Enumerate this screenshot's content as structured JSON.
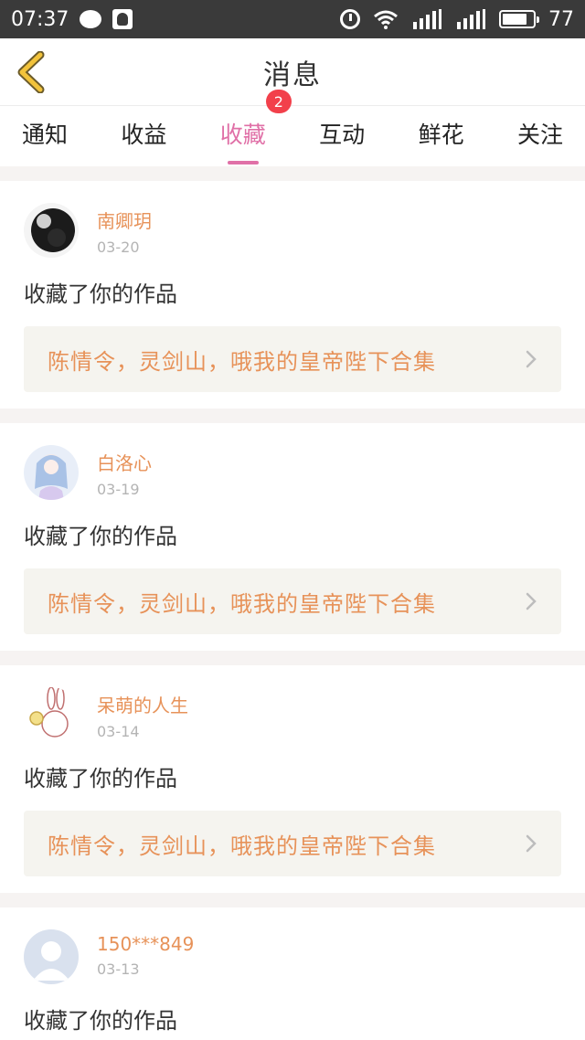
{
  "status_bar": {
    "time": "07:37",
    "battery_level": "77"
  },
  "header": {
    "title": "消息"
  },
  "tabs": [
    {
      "label": "通知"
    },
    {
      "label": "收益"
    },
    {
      "label": "收藏",
      "badge": "2"
    },
    {
      "label": "互动"
    },
    {
      "label": "鲜花"
    },
    {
      "label": "关注"
    }
  ],
  "messages": [
    {
      "username": "南卿玥",
      "date": "03-20",
      "action": "收藏了你的作品",
      "work_title": "陈情令，灵剑山，哦我的皇帝陛下合集"
    },
    {
      "username": "白洛心",
      "date": "03-19",
      "action": "收藏了你的作品",
      "work_title": "陈情令，灵剑山，哦我的皇帝陛下合集"
    },
    {
      "username": "呆萌的人生",
      "date": "03-14",
      "action": "收藏了你的作品",
      "work_title": "陈情令，灵剑山，哦我的皇帝陛下合集"
    },
    {
      "username": "150***849",
      "date": "03-13",
      "action": "收藏了你的作品"
    }
  ],
  "colors": {
    "accent_pink": "#e070a7",
    "username_orange": "#e79259",
    "badge_red": "#f2404b",
    "back_chevron_yellow": "#f2c33b"
  }
}
